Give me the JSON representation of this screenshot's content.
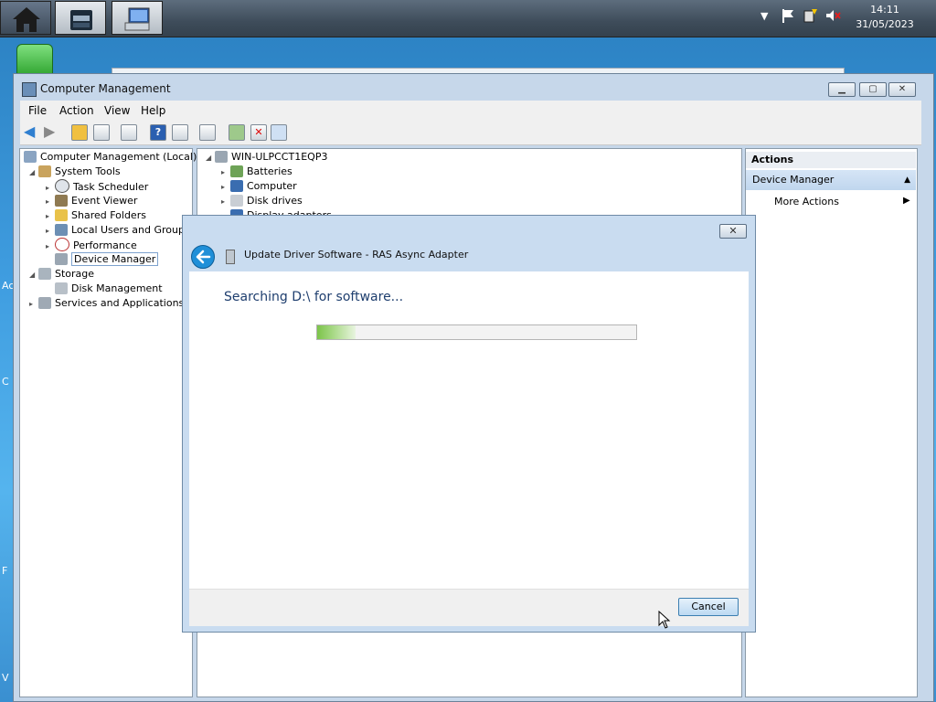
{
  "taskbar": {
    "clock_time": "14:11",
    "clock_date": "31/05/2023",
    "buttons": [
      "home-icon",
      "file-manager-icon",
      "computer-management-icon"
    ],
    "tray_icons": [
      "chevron-down-icon",
      "flag-icon",
      "network-icon",
      "volume-muted-icon"
    ]
  },
  "window": {
    "title": "Computer Management",
    "menu": [
      "File",
      "Action",
      "View",
      "Help"
    ]
  },
  "left_tree": {
    "root": "Computer Management (Local)",
    "system_tools": "System Tools",
    "task_scheduler": "Task Scheduler",
    "event_viewer": "Event Viewer",
    "shared_folders": "Shared Folders",
    "local_users": "Local Users and Groups",
    "performance": "Performance",
    "device_manager": "Device Manager",
    "storage": "Storage",
    "disk_management": "Disk Management",
    "services": "Services and Applications"
  },
  "device_tree": {
    "host": "WIN-ULPCCT1EQP3",
    "items": [
      "Batteries",
      "Computer",
      "Disk drives",
      "Display adapters"
    ]
  },
  "actions": {
    "header": "Actions",
    "section": "Device Manager",
    "more": "More Actions"
  },
  "dialog": {
    "title": "Update Driver Software - RAS Async Adapter",
    "status": "Searching D:\\ for software...",
    "progress_fraction": 0.12,
    "cancel_label": "Cancel"
  }
}
